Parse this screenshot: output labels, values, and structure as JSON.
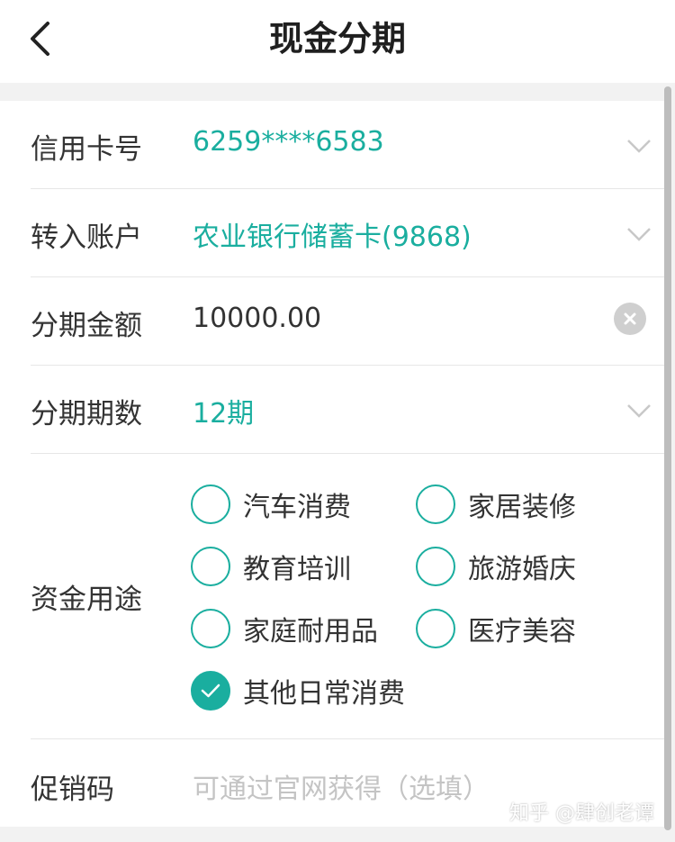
{
  "header": {
    "title": "现金分期"
  },
  "rows": {
    "card": {
      "label": "信用卡号",
      "value": "6259****6583"
    },
    "account": {
      "label": "转入账户",
      "value": "农业银行储蓄卡(9868)"
    },
    "amount": {
      "label": "分期金额",
      "value": "10000.00"
    },
    "periods": {
      "label": "分期期数",
      "value": "12期"
    },
    "purpose": {
      "label": "资金用途",
      "options": [
        {
          "label": "汽车消费",
          "checked": false
        },
        {
          "label": "家居装修",
          "checked": false
        },
        {
          "label": "教育培训",
          "checked": false
        },
        {
          "label": "旅游婚庆",
          "checked": false
        },
        {
          "label": "家庭耐用品",
          "checked": false
        },
        {
          "label": "医疗美容",
          "checked": false
        },
        {
          "label": "其他日常消费",
          "checked": true
        }
      ]
    },
    "promo": {
      "label": "促销码",
      "placeholder": "可通过官网获得（选填）"
    }
  },
  "watermark": "知乎 @肆创老谭",
  "colors": {
    "accent": "#1aae9f",
    "text": "#333333",
    "placeholder": "#c4c4c4"
  },
  "icons": {
    "back": "chevron-left-icon",
    "dropdown": "chevron-down-icon",
    "clear": "clear-circle-icon",
    "check": "check-icon"
  }
}
